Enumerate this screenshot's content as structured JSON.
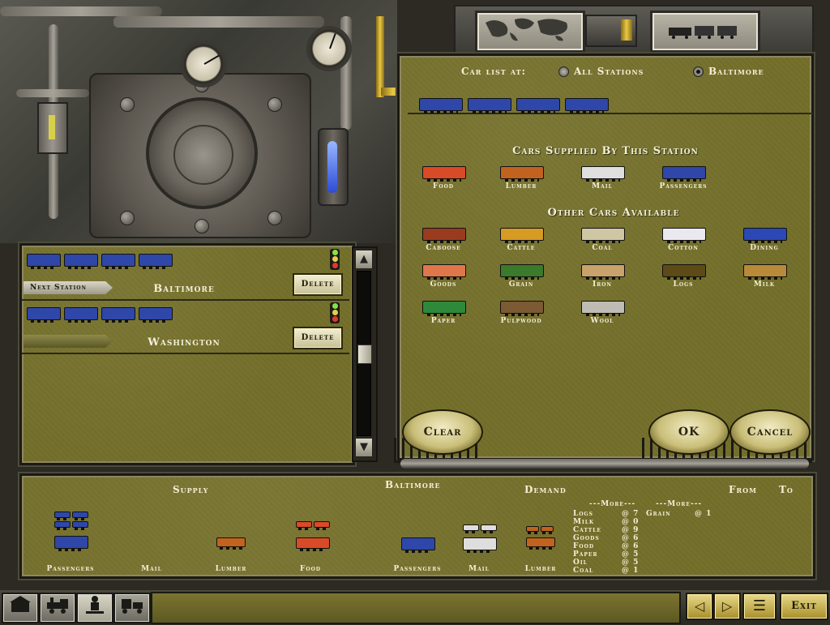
{
  "car_list": {
    "label": "Car list at:",
    "options": [
      {
        "label": "All Stations",
        "selected": false
      },
      {
        "label": "Baltimore",
        "selected": true
      }
    ]
  },
  "supplied": {
    "heading": "Cars Supplied By This Station",
    "cars": [
      {
        "label": "Food",
        "color": "#d94a26"
      },
      {
        "label": "Lumber",
        "color": "#c2621f"
      },
      {
        "label": "Mail",
        "color": "#dedede"
      },
      {
        "label": "Passengers",
        "color": "#2e47a8"
      }
    ]
  },
  "available": {
    "heading": "Other Cars Available",
    "cars": [
      {
        "label": "Caboose",
        "color": "#9a3b1f"
      },
      {
        "label": "Cattle",
        "color": "#d79a22"
      },
      {
        "label": "Coal",
        "color": "#cfc6a3"
      },
      {
        "label": "Cotton",
        "color": "#e9e9ef"
      },
      {
        "label": "Dining",
        "color": "#2b48b4"
      },
      {
        "label": "Goods",
        "color": "#e0774a"
      },
      {
        "label": "Grain",
        "color": "#3a7a2a"
      },
      {
        "label": "Iron",
        "color": "#c9a36b"
      },
      {
        "label": "Logs",
        "color": "#5c4b17"
      },
      {
        "label": "Milk",
        "color": "#b98a3a"
      },
      {
        "label": "Paper",
        "color": "#2e8a3a"
      },
      {
        "label": "Pulpwood",
        "color": "#7c5a34"
      },
      {
        "label": "Wool",
        "color": "#bfbcb3"
      }
    ]
  },
  "buttons": {
    "clear": "Clear",
    "ok": "OK",
    "cancel": "Cancel"
  },
  "consist": {
    "stops": [
      {
        "station": "Baltimore",
        "tag": "Next Station",
        "delete": "Delete"
      },
      {
        "station": "Washington",
        "tag": "",
        "delete": "Delete"
      }
    ]
  },
  "scroll": {
    "up": "▲",
    "down": "▼"
  },
  "supply_demand": {
    "station": "Baltimore",
    "supply_label": "Supply",
    "demand_label": "Demand",
    "from_label": "From",
    "to_label": "To",
    "supply_items": [
      "Passengers",
      "Mail",
      "Lumber",
      "Food"
    ],
    "demand_items": [
      "Passengers",
      "Mail",
      "Lumber"
    ],
    "more1": "---More---",
    "more2": "---More---",
    "demand_list": [
      {
        "name": "Logs",
        "value": "@ 7"
      },
      {
        "name": "Milk",
        "value": "@ 0"
      },
      {
        "name": "Cattle",
        "value": "@ 9"
      },
      {
        "name": "Goods",
        "value": "@ 6"
      },
      {
        "name": "Food",
        "value": "@ 6"
      },
      {
        "name": "Paper",
        "value": "@ 5"
      },
      {
        "name": "Oil",
        "value": "@ 5"
      },
      {
        "name": "Coal",
        "value": "@ 1"
      }
    ],
    "demand_list2": [
      {
        "name": "Grain",
        "value": "@ 1"
      }
    ]
  },
  "bottom": {
    "exit": "Exit",
    "prev": "◁",
    "next": "▷",
    "list": "☰"
  },
  "toolbar_icons": [
    "station-icon",
    "locomotive-icon",
    "manager-icon",
    "train-ops-icon"
  ]
}
